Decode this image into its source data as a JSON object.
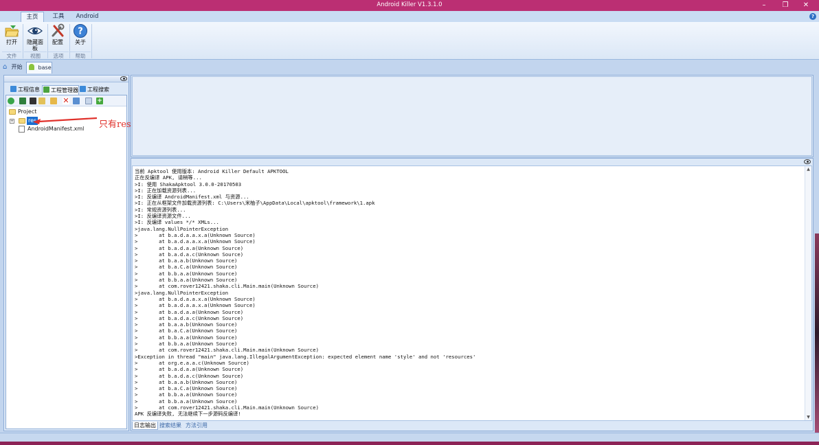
{
  "window": {
    "title": "Android Killer V1.3.1.0",
    "controls": {
      "minimize": "–",
      "restore": "❐",
      "close": "✕"
    }
  },
  "ribbon_tabs": [
    "主页",
    "工具",
    "Android"
  ],
  "ribbon": {
    "buttons": [
      {
        "label": "打开",
        "icon": "folder-open-icon"
      },
      {
        "label": "隐藏面板",
        "icon": "eye-icon"
      },
      {
        "label": "配置",
        "icon": "tools-icon"
      },
      {
        "label": "关于",
        "icon": "help-icon"
      }
    ],
    "groups": [
      "文件",
      "视图",
      "选项",
      "帮助"
    ]
  },
  "doc_tabs": [
    {
      "label": "开始",
      "icon": "home-icon"
    },
    {
      "label": "base",
      "icon": "android-icon"
    }
  ],
  "left_panel": {
    "tabs": [
      "工程信息",
      "工程管理器",
      "工程搜索"
    ],
    "tree": {
      "root": "Project",
      "items": [
        "res",
        "AndroidManifest.xml"
      ]
    },
    "annotation": "只有resource"
  },
  "log": {
    "lines": [
      "当前 Apktool 使用版本: Android Killer Default APKTOOL",
      "正在反编译 APK, 请稍等...",
      ">I: 使用 ShakaApktool 3.0.0-20170503",
      ">I: 正在加载资源列表...",
      ">I: 反编译 AndroidManifest.xml 与资源...",
      ">I: 正在从框架文件加载资源列表: C:\\Users\\米柚子\\AppData\\Local\\apktool\\framework\\1.apk",
      ">I: 常规资源列表...",
      ">I: 反编译资源文件...",
      ">I: 反编译 values */* XMLs...",
      ">java.lang.NullPointerException",
      ">       at b.a.d.a.a.x.a(Unknown Source)",
      ">       at b.a.d.a.a.x.a(Unknown Source)",
      ">       at b.a.d.a.a(Unknown Source)",
      ">       at b.a.d.a.c(Unknown Source)",
      ">       at b.a.a.b(Unknown Source)",
      ">       at b.a.C.a(Unknown Source)",
      ">       at b.b.a.a(Unknown Source)",
      ">       at b.b.a.a(Unknown Source)",
      ">       at com.rover12421.shaka.cli.Main.main(Unknown Source)",
      ">java.lang.NullPointerException",
      ">       at b.a.d.a.a.x.a(Unknown Source)",
      ">       at b.a.d.a.a.x.a(Unknown Source)",
      ">       at b.a.d.a.a(Unknown Source)",
      ">       at b.a.d.a.c(Unknown Source)",
      ">       at b.a.a.b(Unknown Source)",
      ">       at b.a.C.a(Unknown Source)",
      ">       at b.b.a.a(Unknown Source)",
      ">       at b.b.a.a(Unknown Source)",
      ">       at com.rover12421.shaka.cli.Main.main(Unknown Source)",
      ">Exception in thread \"main\" java.lang.IllegalArgumentException: expected element name 'style' and not 'resources'",
      ">       at org.e.a.a.c(Unknown Source)",
      ">       at b.a.d.a.a(Unknown Source)",
      ">       at b.a.d.a.c(Unknown Source)",
      ">       at b.a.a.b(Unknown Source)",
      ">       at b.a.C.a(Unknown Source)",
      ">       at b.b.a.a(Unknown Source)",
      ">       at b.b.a.a(Unknown Source)",
      ">       at com.rover12421.shaka.cli.Main.main(Unknown Source)",
      "APK 反编译失败, 无法继续下一步源码反编译!"
    ]
  },
  "bottom_tabs": [
    "日志输出",
    "搜索结果",
    "方法引用"
  ],
  "colors": {
    "titlebar": "#bb2f73",
    "ribbon_bg": "#dbe7f6",
    "selection": "#1b6fd1",
    "annotation": "#e0312b"
  }
}
